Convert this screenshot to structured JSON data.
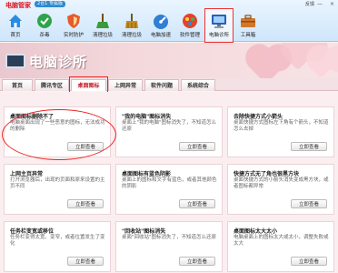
{
  "app": {
    "name": "电脑管家",
    "version_badge": "2合1 专属版",
    "user": "反馈",
    "controls": [
      "—",
      "×"
    ]
  },
  "toolbar": {
    "items": [
      {
        "label": "首页",
        "icon": "home-icon",
        "color": "#2b8be0"
      },
      {
        "label": "杀毒",
        "icon": "antivirus-icon",
        "color": "#2fa34a"
      },
      {
        "label": "实时防护",
        "icon": "shield-icon",
        "color": "#e65b2a"
      },
      {
        "label": "清理垃圾",
        "icon": "broom-icon",
        "color": "#3a9a3a"
      },
      {
        "label": "清理垃圾",
        "icon": "broom-icon",
        "color": "#c68b1e"
      },
      {
        "label": "电脑加速",
        "icon": "speedup-icon",
        "color": "#2f7fd5"
      },
      {
        "label": "软件管理",
        "icon": "software-icon",
        "color": "#e4412c"
      },
      {
        "label": "电脑诊所",
        "icon": "clinic-icon",
        "color": "#2a5fb4"
      },
      {
        "label": "工具箱",
        "icon": "toolbox-icon",
        "color": "#d1772a"
      }
    ],
    "active_index": 7
  },
  "banner": {
    "title": "电脑诊所"
  },
  "tabs": {
    "items": [
      "首页",
      "腾讯专区",
      "桌面图标",
      "上网异常",
      "软件问题",
      "系统综合"
    ],
    "active_index": 2
  },
  "cards": [
    {
      "title": "桌面图标删除不了",
      "desc": "电脑桌面出现了一些恶意的图标，无法成功的删除",
      "button": "立即查看"
    },
    {
      "title": "\"我的电脑\"图标消失",
      "desc": "桌面上\"我的电脑\"图标消失了，不知道怎么还原",
      "button": "立即查看"
    },
    {
      "title": "去除快捷方式小箭头",
      "desc": "桌面快捷方式图标左下角有个箭头，不知道怎么去掉",
      "button": "立即查看"
    },
    {
      "title": "上网主页异常",
      "desc": "打开浏览器后，出现的页面和原来设置的主页不同",
      "button": "立即查看"
    },
    {
      "title": "桌面图标有蓝色阴影",
      "desc": "桌面上的图标和文字有蓝色，或者其他颜色的阴影",
      "button": "立即查看"
    },
    {
      "title": "快捷方式无了角也很黑方块",
      "desc": "桌面快捷方式的小箭头消失变成黑方块，或者图标都异常",
      "button": "立即查看"
    },
    {
      "title": "任务栏变宽或移位",
      "desc": "任务栏变得太宽、变窄，或者位置发生了变化",
      "button": "立即查看"
    },
    {
      "title": "\"回收站\"图标消失",
      "desc": "桌面\"回收站\"图标消失了，不知道怎么还原",
      "button": "立即查看"
    },
    {
      "title": "桌面图标太大太小",
      "desc": "电脑桌面上的图标太大或太小，调整失败或太大",
      "button": "立即查看"
    }
  ]
}
